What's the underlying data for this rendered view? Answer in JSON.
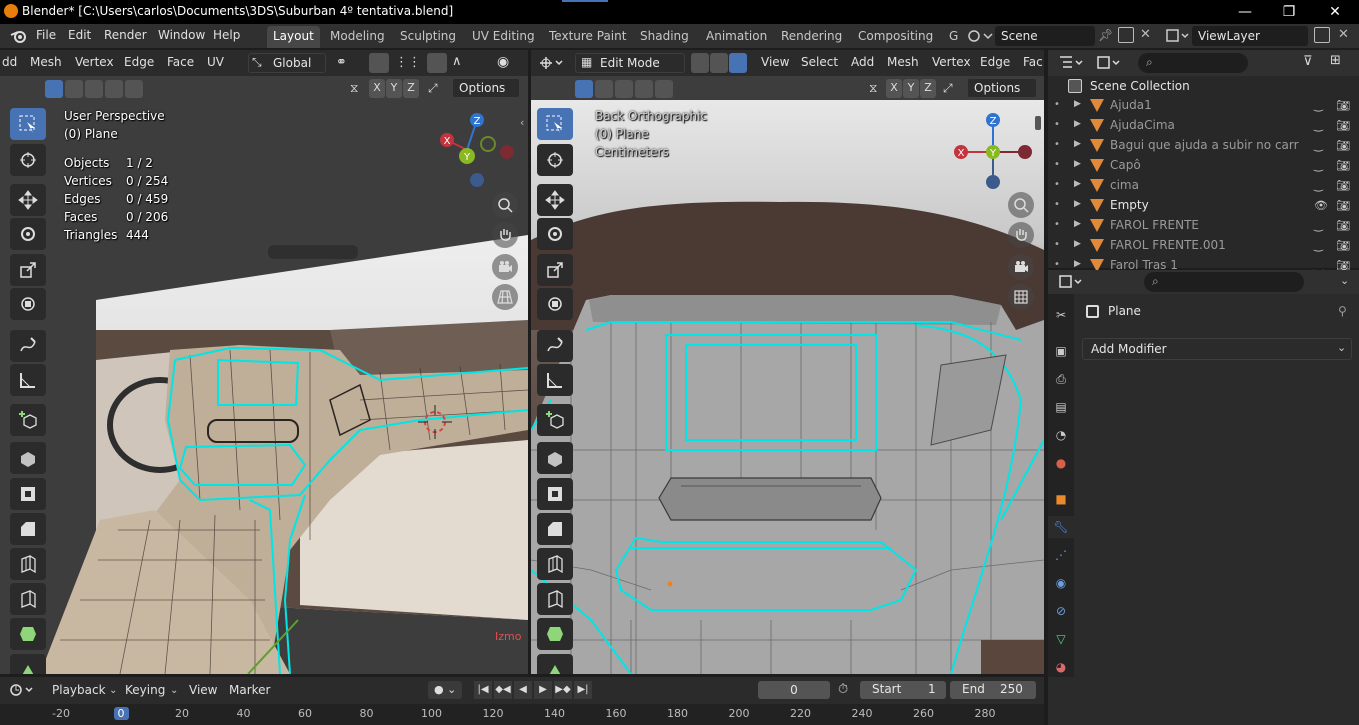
{
  "window": {
    "title": "Blender* [C:\\Users\\carlos\\Documents\\3DS\\Suburban 4º tentativa.blend]",
    "minimize": "—",
    "maximize": "❐",
    "close": "✕"
  },
  "menu": [
    "File",
    "Edit",
    "Render",
    "Window",
    "Help"
  ],
  "workspace_tabs": [
    "Layout",
    "Modeling",
    "Sculpting",
    "UV Editing",
    "Texture Paint",
    "Shading",
    "Animation",
    "Rendering",
    "Compositing",
    "G"
  ],
  "scene": {
    "name": "Scene",
    "view_layer": "ViewLayer"
  },
  "left_viewport": {
    "header_menus": [
      "dd",
      "Mesh",
      "Vertex",
      "Edge",
      "Face",
      "UV"
    ],
    "transform_orientation": "Global",
    "options": "Options",
    "axes": [
      "X",
      "Y",
      "Z"
    ],
    "view_name": "User Perspective",
    "object_name": "(0) Plane",
    "stats": [
      {
        "label": "Objects",
        "value": "1 / 2"
      },
      {
        "label": "Vertices",
        "value": "0 / 254"
      },
      {
        "label": "Edges",
        "value": "0 / 459"
      },
      {
        "label": "Faces",
        "value": "0 / 206"
      },
      {
        "label": "Triangles",
        "value": "444"
      }
    ],
    "gizmo": {
      "x": "X",
      "y": "Y",
      "z": "Z"
    },
    "watermark": "Izmo"
  },
  "right_viewport": {
    "mode": "Edit Mode",
    "header_menus": [
      "View",
      "Select",
      "Add",
      "Mesh",
      "Vertex",
      "Edge",
      "Fac"
    ],
    "options": "Options",
    "axes": [
      "X",
      "Y",
      "Z"
    ],
    "view_name": "Back Orthographic",
    "object_name": "(0) Plane",
    "units": "Centimeters",
    "gizmo": {
      "x": "X",
      "y": "Y",
      "z": "Z"
    }
  },
  "outliner": {
    "root": "Scene Collection",
    "items": [
      {
        "name": "Ajuda1",
        "dim": true
      },
      {
        "name": "AjudaCima",
        "dim": true
      },
      {
        "name": "Bagui que ajuda a subir no carr",
        "dim": true
      },
      {
        "name": "Capô",
        "dim": true
      },
      {
        "name": "cima",
        "dim": true
      },
      {
        "name": "Empty",
        "dim": false
      },
      {
        "name": "FAROL FRENTE",
        "dim": true
      },
      {
        "name": "FAROL FRENTE.001",
        "dim": true
      },
      {
        "name": "Farol Tras 1",
        "dim": true
      }
    ]
  },
  "properties": {
    "object": "Plane",
    "add_modifier": "Add Modifier"
  },
  "timeline": {
    "menus": [
      "Playback",
      "Keying",
      "View",
      "Marker"
    ],
    "current_frame": "0",
    "start_label": "Start",
    "start": "1",
    "end_label": "End",
    "end": "250",
    "ticks": [
      "-20",
      "0",
      "20",
      "40",
      "60",
      "80",
      "100",
      "120",
      "140",
      "160",
      "180",
      "200",
      "220",
      "240",
      "260",
      "280"
    ]
  },
  "colors": {
    "accent": "#4772b3",
    "mesh_edge": "#00e5e5",
    "x_axis": "#c4343f",
    "y_axis": "#8ab822",
    "z_axis": "#2e74d0"
  }
}
